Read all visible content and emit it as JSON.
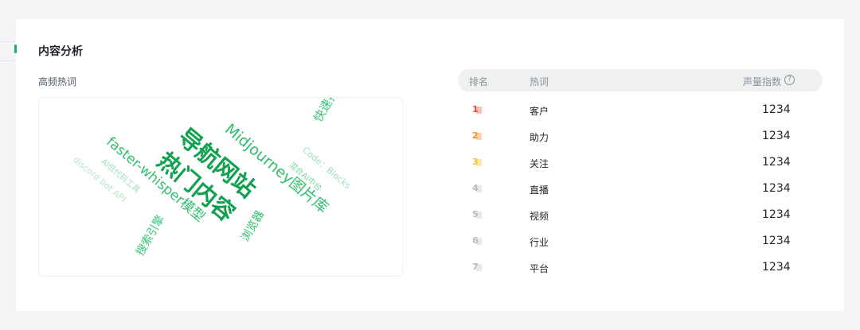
{
  "section": {
    "title": "内容分析",
    "subtitle": "高频热词"
  },
  "word_cloud": {
    "words": [
      {
        "text": "导航网站"
      },
      {
        "text": "热门内容"
      },
      {
        "text": "Midjourney图片库"
      },
      {
        "text": "faster-whisper模型"
      },
      {
        "text": "快速打字"
      },
      {
        "text": "Code：Blocks"
      },
      {
        "text": "混合AI中台"
      },
      {
        "text": "AI低代码工具"
      },
      {
        "text": "discord  bot API"
      },
      {
        "text": "搜索引擎"
      },
      {
        "text": "浏览器"
      }
    ]
  },
  "table": {
    "headers": {
      "rank": "排名",
      "word": "热词",
      "index": "声量指数"
    },
    "rows": [
      {
        "rank": "1",
        "word": "客户",
        "value": "1234",
        "color": "#f5483b"
      },
      {
        "rank": "2",
        "word": "助力",
        "value": "1234",
        "color": "#ff8a1f"
      },
      {
        "rank": "3",
        "word": "关注",
        "value": "1234",
        "color": "#f7c21b"
      },
      {
        "rank": "4",
        "word": "直播",
        "value": "1234",
        "color": "#b8bcc2"
      },
      {
        "rank": "5",
        "word": "视频",
        "value": "1234",
        "color": "#b8bcc2"
      },
      {
        "rank": "6",
        "word": "行业",
        "value": "1234",
        "color": "#b8bcc2"
      },
      {
        "rank": "7",
        "word": "平台",
        "value": "1234",
        "color": "#b8bcc2"
      }
    ]
  },
  "colors": {
    "accent": "#19b35c",
    "header_bg": "#eef1f0"
  },
  "icons": {
    "help": "question-circle-icon"
  }
}
